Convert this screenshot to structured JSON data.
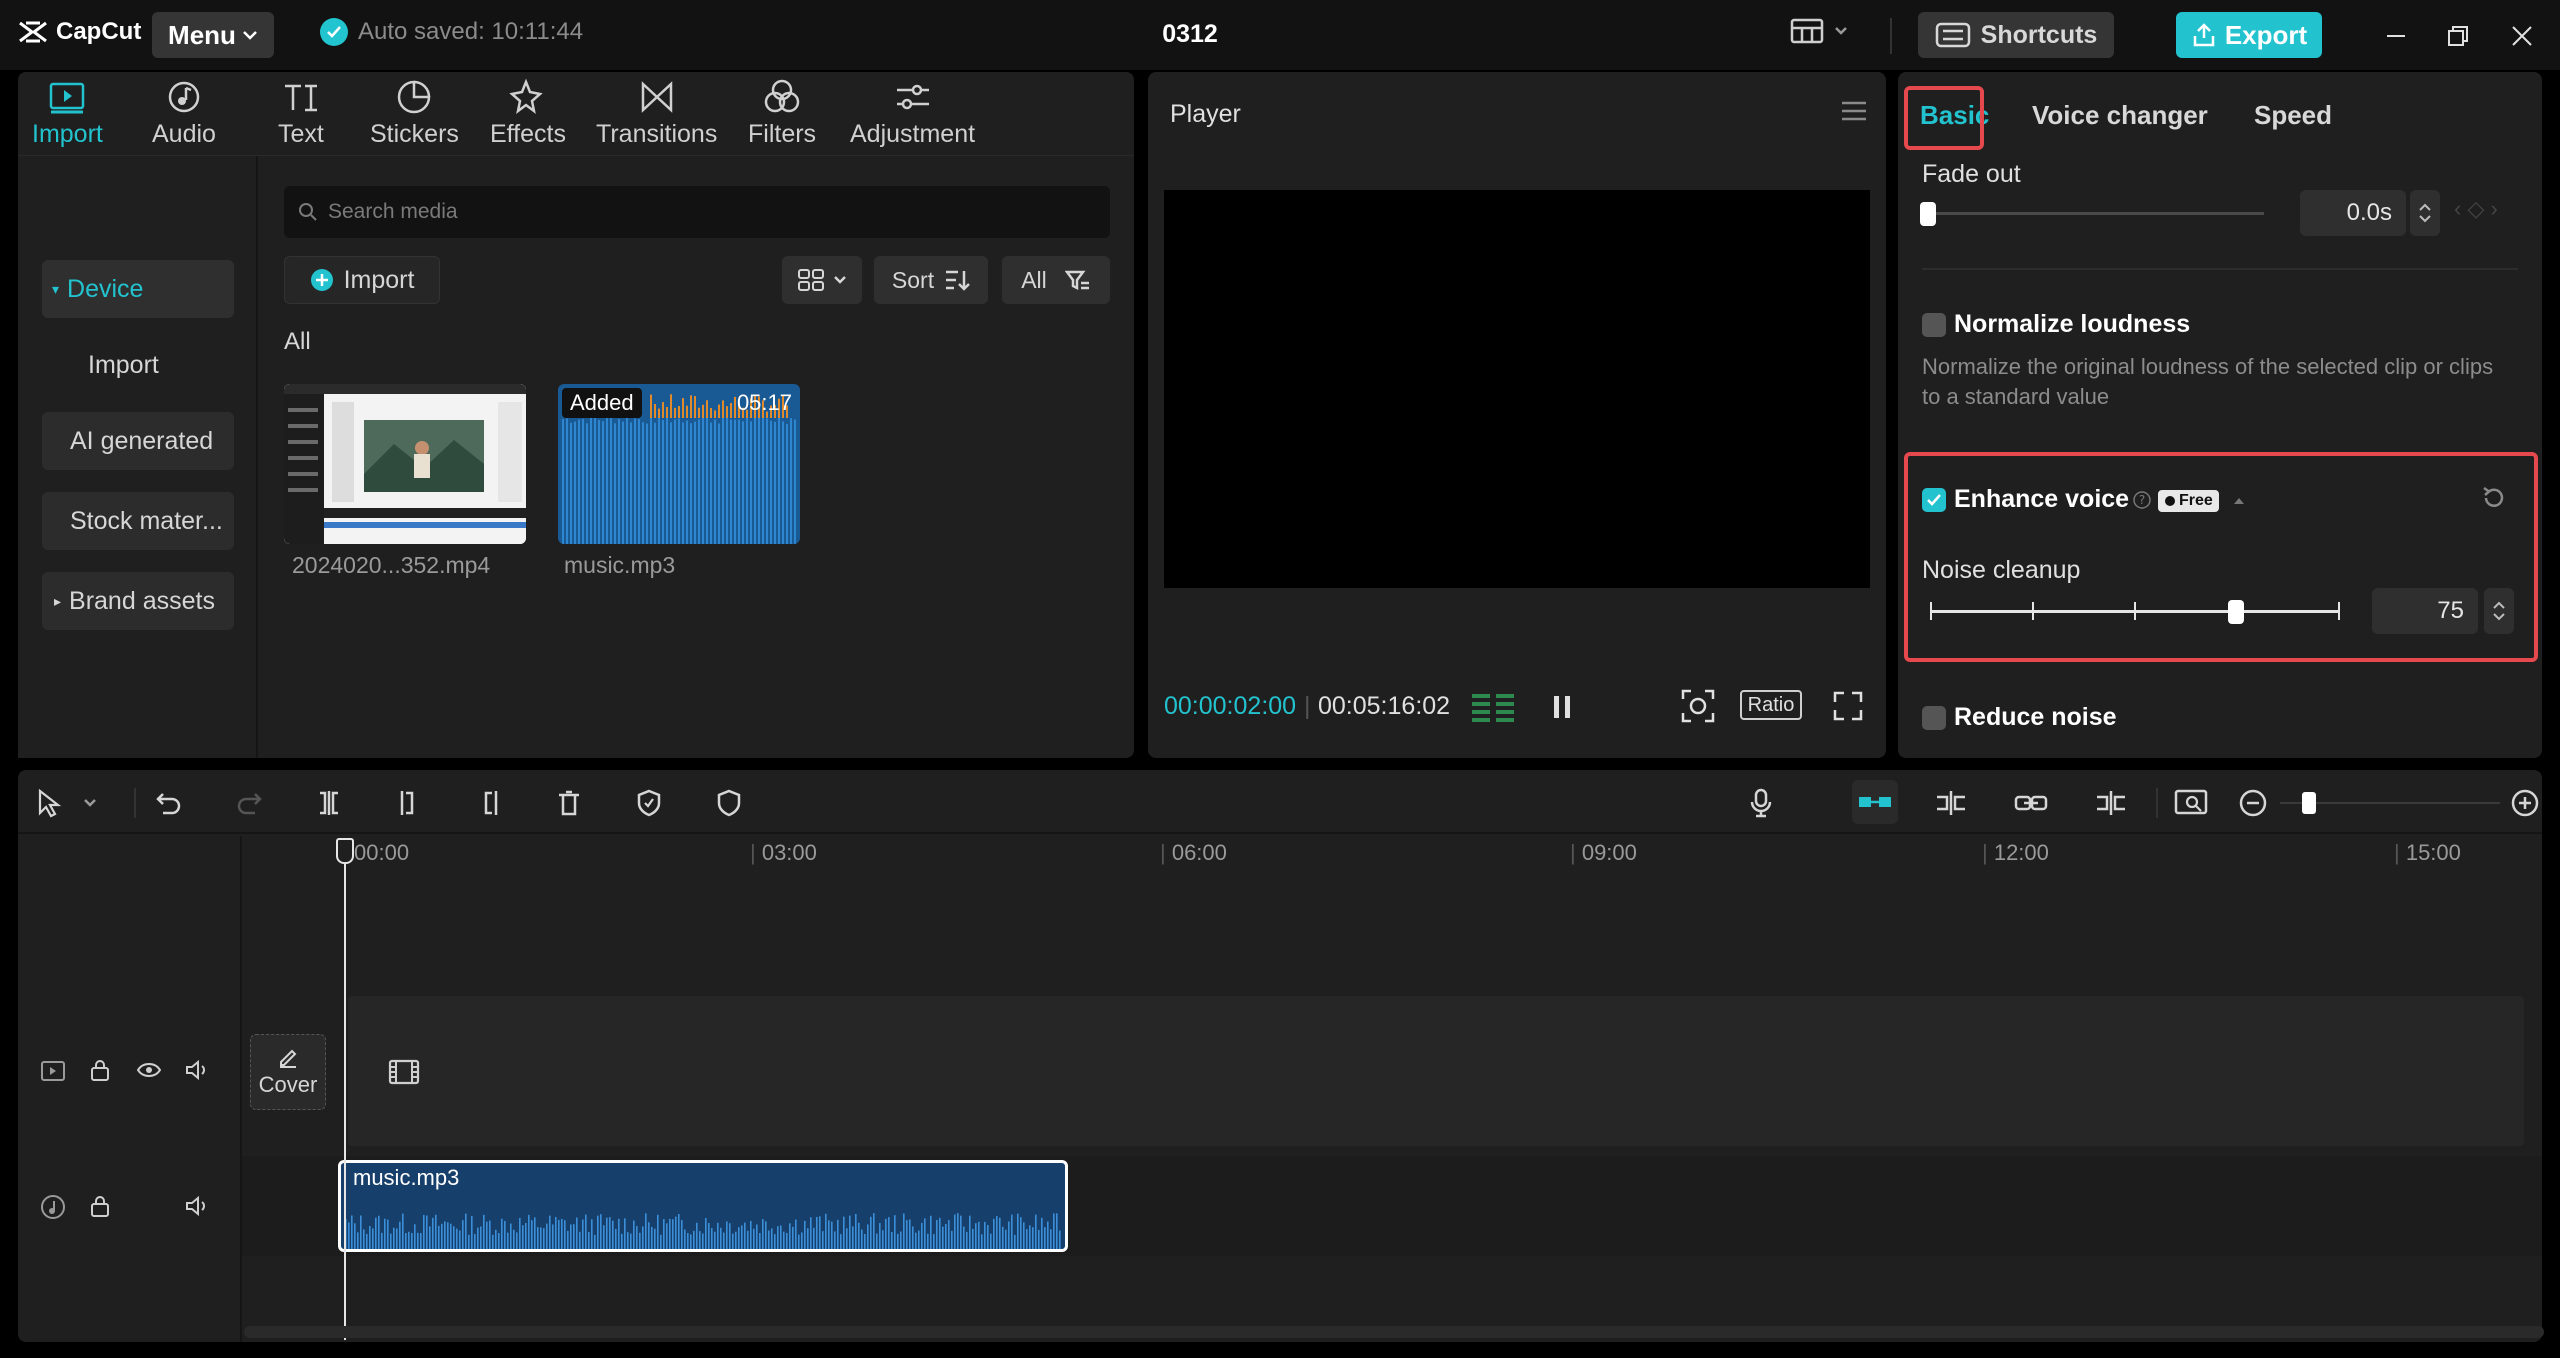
{
  "app": {
    "brand": "CapCut",
    "menu_label": "Menu",
    "autosave": "Auto saved: 10:11:44",
    "project_title": "0312",
    "shortcuts_label": "Shortcuts",
    "export_label": "Export"
  },
  "colors": {
    "accent": "#22c3cf",
    "highlight": "#e5484d",
    "panel": "#1f1f1f",
    "clip": "#173f6b"
  },
  "media": {
    "tabs": [
      {
        "label": "Import",
        "icon": "import-icon"
      },
      {
        "label": "Audio",
        "icon": "audio-icon"
      },
      {
        "label": "Text",
        "icon": "text-icon"
      },
      {
        "label": "Stickers",
        "icon": "stickers-icon"
      },
      {
        "label": "Effects",
        "icon": "effects-icon"
      },
      {
        "label": "Transitions",
        "icon": "transitions-icon"
      },
      {
        "label": "Filters",
        "icon": "filters-icon"
      },
      {
        "label": "Adjustment",
        "icon": "adjustment-icon"
      }
    ],
    "sidebar": [
      "Device",
      "Import",
      "AI generated",
      "Stock mater...",
      "Brand assets"
    ],
    "search_placeholder": "Search media",
    "import_button": "Import",
    "sort_label": "Sort",
    "filter_label": "All",
    "section_label": "All",
    "items": [
      {
        "name": "2024020...352.mp4"
      },
      {
        "name": "music.mp3",
        "badge": "Added",
        "duration": "05:17"
      }
    ]
  },
  "player": {
    "title": "Player",
    "current_time": "00:00:02:00",
    "total_time": "00:05:16:02",
    "ratio_label": "Ratio"
  },
  "properties": {
    "tabs": [
      "Basic",
      "Voice changer",
      "Speed"
    ],
    "fade_out_label": "Fade out",
    "fade_out_value": "0.0s",
    "normalize_label": "Normalize loudness",
    "normalize_desc": "Normalize the original loudness of the selected clip or clips to a standard value",
    "enhance_label": "Enhance voice",
    "free_badge": "Free",
    "noise_cleanup_label": "Noise cleanup",
    "noise_cleanup_value": "75",
    "noise_cleanup_level": 0.75,
    "reduce_noise_label": "Reduce noise"
  },
  "timeline": {
    "ruler": [
      "00:00",
      "03:00",
      "06:00",
      "09:00",
      "12:00",
      "15:00"
    ],
    "cover_label": "Cover",
    "audio_clip_name": "music.mp3"
  }
}
